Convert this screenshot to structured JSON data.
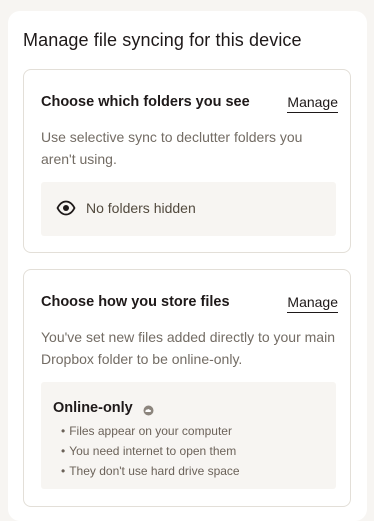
{
  "page": {
    "title": "Manage file syncing for this device"
  },
  "folders_card": {
    "title": "Choose which folders you see",
    "manage_label": "Manage",
    "description": "Use selective sync to declutter folders you aren't using.",
    "status_icon": "eye-icon",
    "status_text": "No folders hidden"
  },
  "storage_card": {
    "title": "Choose how you store files",
    "manage_label": "Manage",
    "description": "You've set new files added directly to your main Dropbox folder to be online-only.",
    "mode_title": "Online-only",
    "mode_icon": "cloud-online-icon",
    "bullet_glyph": "•",
    "bullets": [
      "Files appear on your computer",
      "You need internet to open them",
      "They don't use hard drive space"
    ]
  }
}
